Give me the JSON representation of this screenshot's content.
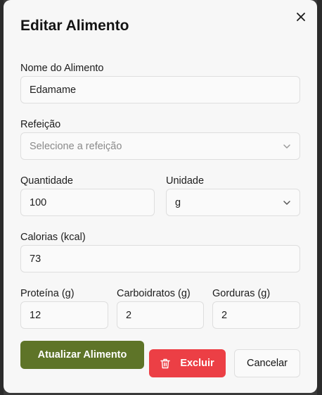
{
  "modal": {
    "title": "Editar Alimento",
    "close_icon": "close-icon"
  },
  "form": {
    "name": {
      "label": "Nome do Alimento",
      "value": "Edamame"
    },
    "meal": {
      "label": "Refeição",
      "placeholder": "Selecione a refeição",
      "value": ""
    },
    "quantity": {
      "label": "Quantidade",
      "value": "100"
    },
    "unit": {
      "label": "Unidade",
      "value": "g"
    },
    "calories": {
      "label": "Calorias (kcal)",
      "value": "73"
    },
    "protein": {
      "label": "Proteína (g)",
      "value": "12"
    },
    "carbs": {
      "label": "Carboidratos (g)",
      "value": "2"
    },
    "fat": {
      "label": "Gorduras (g)",
      "value": "2"
    }
  },
  "actions": {
    "update_label": "Atualizar Alimento",
    "delete_label": "Excluir",
    "delete_icon": "trash-icon",
    "cancel_label": "Cancelar"
  },
  "colors": {
    "primary": "#5e7428",
    "danger": "#ec3f45",
    "modal_bg": "#f7f7f7",
    "overlay": "#3a3a3a"
  }
}
